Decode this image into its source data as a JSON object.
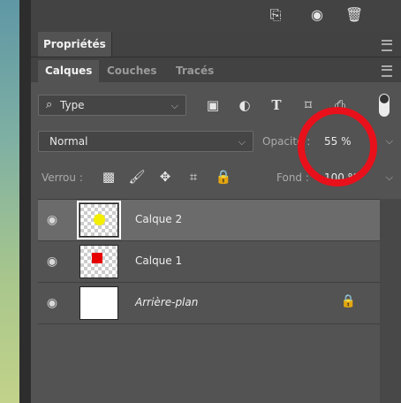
{
  "toolbar_top": {
    "icons": [
      "new-layer-icon",
      "camera-icon",
      "trash-icon"
    ]
  },
  "properties_tab": {
    "label": "Propriétés"
  },
  "tabs": [
    {
      "label": "Calques",
      "active": true
    },
    {
      "label": "Couches",
      "active": false
    },
    {
      "label": "Tracés",
      "active": false
    }
  ],
  "filter": {
    "label": "Type",
    "icons": [
      "image-filter-icon",
      "adjustment-filter-icon",
      "type-filter-icon",
      "shape-filter-icon",
      "smart-object-filter-icon",
      "filter-toggle-icon"
    ]
  },
  "blend": {
    "mode": "Normal",
    "opacity_label": "Opacité :",
    "opacity_value": "55 %"
  },
  "lock": {
    "label": "Verrou :",
    "fill_label": "Fond :",
    "fill_value": "100 %"
  },
  "layers": [
    {
      "name": "Calque 2",
      "selected": true,
      "dot_color": "#f4ef00",
      "dot_shape": "circle"
    },
    {
      "name": "Calque 1",
      "selected": false,
      "dot_color": "#e60000",
      "dot_shape": "square"
    },
    {
      "name": "Arrière-plan",
      "selected": false,
      "italic": true,
      "locked": true
    }
  ],
  "colors": {
    "panel": "#535353",
    "selected_row": "#6b6b6b",
    "highlight_circle": "#e8101a"
  }
}
